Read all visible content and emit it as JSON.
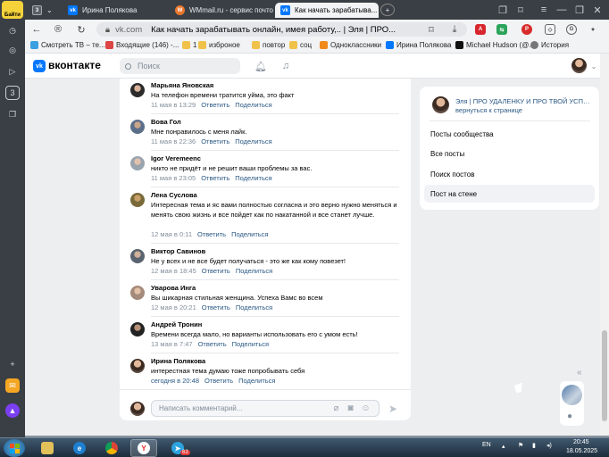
{
  "colors": {
    "vk_blue": "#0077ff",
    "link": "#2a5885",
    "meta": "#818c99",
    "tab_bar": "#3a3f45"
  },
  "browser": {
    "rail": {
      "logo_label": "Байти",
      "badge": "3"
    },
    "tabs": [
      {
        "badge": "3",
        "icon": "chevron-down-icon"
      },
      {
        "label": "Ирина Полякова",
        "icon": "vk-icon"
      },
      {
        "label": "WMmail.ru - сервис почтов...",
        "icon": "wmmail-icon"
      },
      {
        "label": "Как начать зарабатыва...",
        "icon": "vk-icon",
        "active": true
      }
    ],
    "address": {
      "domain": "vk.com",
      "title": "Как начать зарабатывать онлайн, имея работу,.. | Эля | ПРО..."
    },
    "bookmarks": [
      "Смотреть ТВ – те...",
      "Входящие (146) -...",
      "изброное",
      "1",
      "повтор",
      "соц",
      "Одноклассники",
      "Ирина Полякова",
      "Michael Hudson (@...",
      "История"
    ]
  },
  "vk": {
    "logo_text": "вконтакте",
    "search_placeholder": "Поиск",
    "comments": [
      {
        "name": "Марьяна Яновская",
        "text": "На телефон времени тратится уйма, это факт",
        "date": "11 мая в 13:29",
        "reply": "Ответить",
        "share": "Поделиться"
      },
      {
        "name": "Вова Гол",
        "text": "Мне понравилось с меня лайк.",
        "date": "11 мая в 22:36",
        "reply": "Ответить",
        "share": "Поделиться"
      },
      {
        "name": "Igor Veremeenc",
        "text": "никто не придёт и не решит ваши проблемы за вас.",
        "date": "11 мая в 23:05",
        "reply": "Ответить",
        "share": "Поделиться"
      },
      {
        "name": "Лена Суслова",
        "text": "Интересная тема и яс вами полностью согласна и это верно нужно меняться и менять свою жизнь и все пойдет как по накатанной и все станет лучше.",
        "date": "12 мая в 0:11",
        "reply": "Ответить",
        "share": "Поделиться"
      },
      {
        "name": "Виктор Савинов",
        "text": "Не у всех и не все будет получаться - это же как кому повезет!",
        "date": "12 мая в 18:45",
        "reply": "Ответить",
        "share": "Поделиться"
      },
      {
        "name": "Уварова Инга",
        "text": "Вы шикарная стильная женщина. Успеха Вамс во всем",
        "date": "12 мая в 20:21",
        "reply": "Ответить",
        "share": "Поделиться"
      },
      {
        "name": "Андрей Тронин",
        "text": "Времени всегда мало, но варианты использовать его с умом есть!",
        "date": "13 мая в 7:47",
        "reply": "Ответить",
        "share": "Поделиться"
      },
      {
        "name": "Ирина Полякова",
        "text": "интерестная тема думаю тоже попробывать себя",
        "date": "сегодня в 20:48",
        "reply": "Ответить",
        "share": "Поделиться"
      }
    ],
    "compose_placeholder": "Написать комментарий...",
    "sidebar": {
      "title": "Эля | ПРО УДАЛЕНКУ И ПРО ТВОЙ УСПЕХ...",
      "back": "вернуться к странице",
      "items": [
        "Посты сообщества",
        "Все посты",
        "Поиск постов",
        "Пост на стене"
      ]
    }
  },
  "taskbar": {
    "lang": "EN",
    "time": "20:45",
    "date": "18.05.2025",
    "telegram_badge": "63"
  }
}
